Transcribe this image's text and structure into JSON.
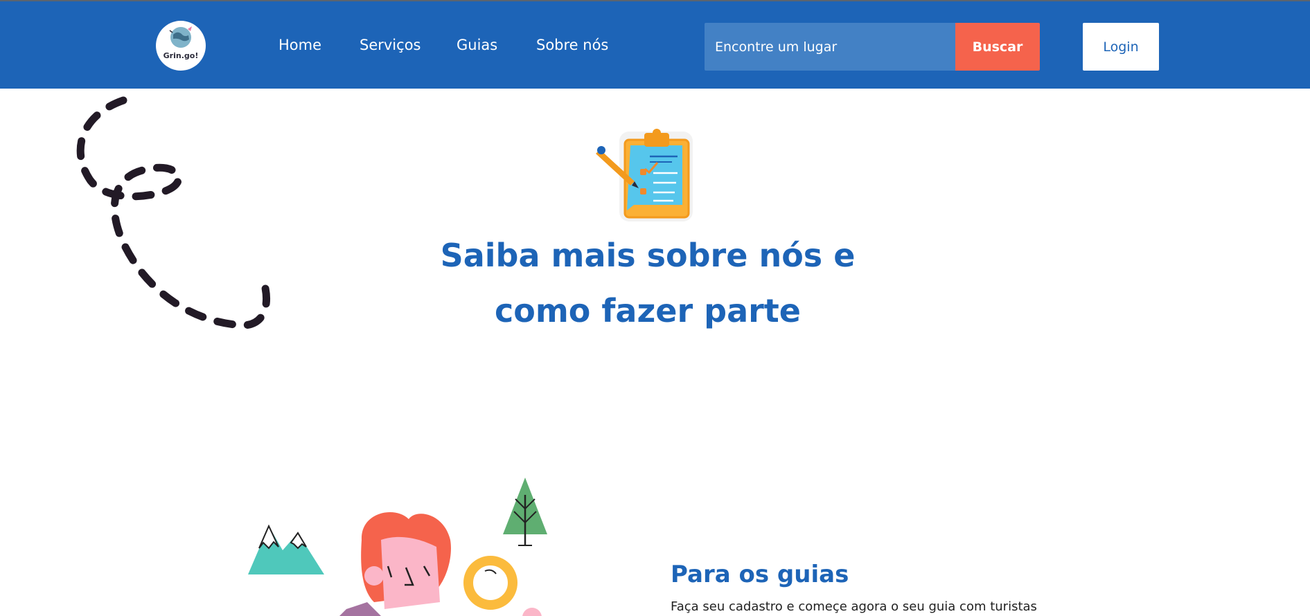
{
  "nav": {
    "logo_text": "Grin.go!",
    "links": [
      "Home",
      "Serviços",
      "Guias",
      "Sobre nós"
    ],
    "search_placeholder": "Encontre um lugar",
    "search_button": "Buscar",
    "login_button": "Login"
  },
  "hero": {
    "title_line1": "Saiba mais sobre nós e",
    "title_line2": "como fazer parte"
  },
  "section": {
    "title": "Para os guias",
    "text": "Faça seu cadastro e começe agora o seu guia com turistas"
  },
  "colors": {
    "primary": "#1d64b7",
    "accent": "#f5634c"
  }
}
